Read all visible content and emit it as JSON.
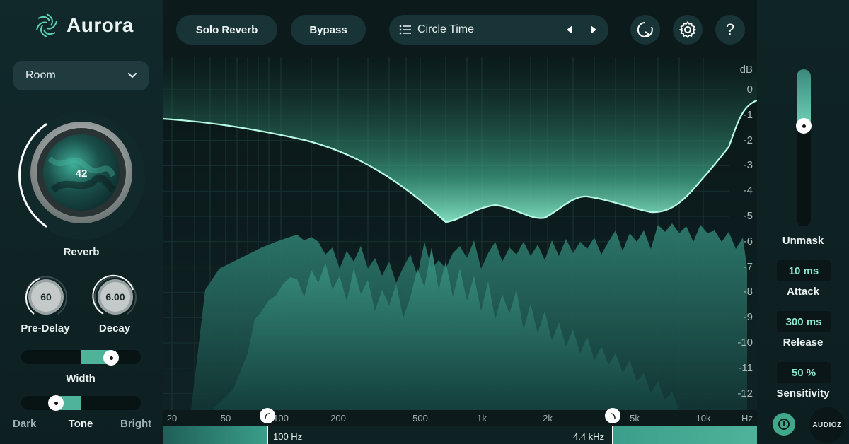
{
  "app": {
    "name": "Aurora"
  },
  "left": {
    "room_dropdown": {
      "value": "Room"
    },
    "reverb_knob": {
      "value": "42",
      "label": "Reverb",
      "level": 0.42
    },
    "predelay_knob": {
      "value": "60",
      "label": "Pre-Delay"
    },
    "decay_knob": {
      "value": "6.00",
      "label": "Decay"
    },
    "width_slider": {
      "label": "Width",
      "level": 0.75
    },
    "tone_slider": {
      "label": "Tone",
      "left_label": "Dark",
      "right_label": "Bright",
      "level": 0.3
    }
  },
  "toolbar": {
    "solo_reverb_label": "Solo Reverb",
    "bypass_label": "Bypass",
    "preset_name": "Circle Time"
  },
  "spectrum": {
    "db_unit": "dB",
    "db_ticks": [
      "0",
      "-1",
      "-2",
      "-3",
      "-4",
      "-5",
      "-6",
      "-7",
      "-8",
      "-9",
      "-10",
      "-11",
      "-12"
    ],
    "freq_ticks": [
      "20",
      "50",
      "100",
      "200",
      "500",
      "1k",
      "2k",
      "5k",
      "10k",
      "Hz"
    ],
    "low_handle_label": "100 Hz",
    "high_handle_label": "4.4 kHz"
  },
  "right": {
    "unmask": {
      "label": "Unmask",
      "level": 0.75
    },
    "attack": {
      "value": "10 ms",
      "label": "Attack"
    },
    "release": {
      "value": "300 ms",
      "label": "Release"
    },
    "sensitivity": {
      "value": "50 %",
      "label": "Sensitivity"
    }
  },
  "watermark": "AUDIOZ",
  "colors": {
    "accent": "#7fe6c6",
    "teal": "#4fb39a",
    "bg": "#0c1a1c"
  }
}
